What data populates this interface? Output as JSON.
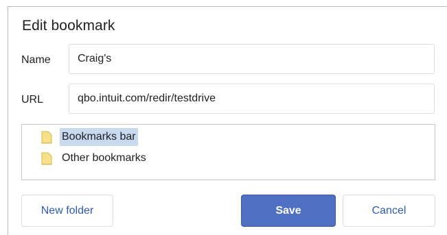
{
  "dialog": {
    "title": "Edit bookmark"
  },
  "name_field": {
    "label": "Name",
    "value": "Craig's"
  },
  "url_field": {
    "label": "URL",
    "value": "qbo.intuit.com/redir/testdrive"
  },
  "folders": {
    "items": [
      {
        "label": "Bookmarks bar",
        "icon": "folder-icon",
        "selected": true
      },
      {
        "label": "Other bookmarks",
        "icon": "folder-icon",
        "selected": false
      }
    ]
  },
  "buttons": {
    "new_folder": "New folder",
    "save": "Save",
    "cancel": "Cancel"
  },
  "colors": {
    "primary": "#4e6fc2",
    "link_text": "#2f5cb0",
    "selection": "#c8d8ee",
    "folder": "#f6e08a"
  }
}
